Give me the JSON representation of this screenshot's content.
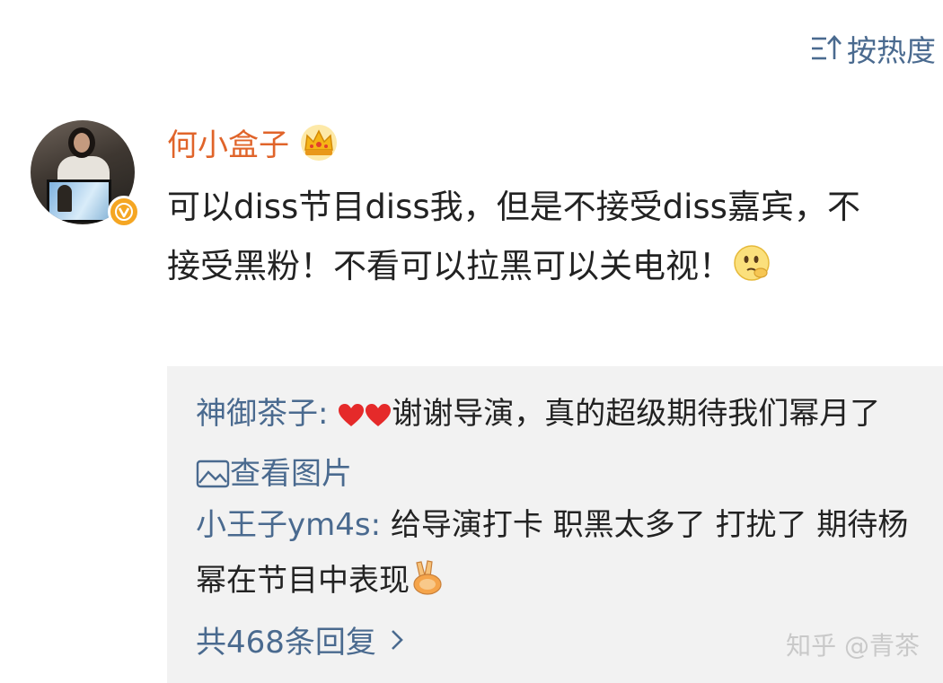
{
  "sort": {
    "label": "按热度",
    "icon": "sort-icon"
  },
  "comment": {
    "username": "何小盒子",
    "member_badge": "crown-icon",
    "verified_badge": "verified-v-icon",
    "text": "可以diss节目diss我，但是不接受diss嘉宾，不接受黑粉！不看可以拉黑可以关电视！",
    "trailing_emoji": "thinking-emoji-icon"
  },
  "replies": [
    {
      "user": "神御茶子",
      "separator": ":",
      "prefix_emoji": "heart-icon",
      "text": "谢谢导演，真的超级期待我们幂月了",
      "link_label": "查看图片",
      "link_icon": "image-icon"
    },
    {
      "user": "小王子ym4s",
      "separator": ":",
      "text": "给导演打卡 职黑太多了 打扰了 期待杨幂在节目中表现",
      "trailing_emoji": "victory-hand-emoji-icon"
    }
  ],
  "more_replies": {
    "label": "共468条回复",
    "icon": "chevron-right-icon"
  },
  "watermark": "知乎 @青茶",
  "colors": {
    "link_blue": "#4a6a8f",
    "username_orange": "#e0642a",
    "reply_bg": "#f2f2f2",
    "text": "#222222"
  }
}
